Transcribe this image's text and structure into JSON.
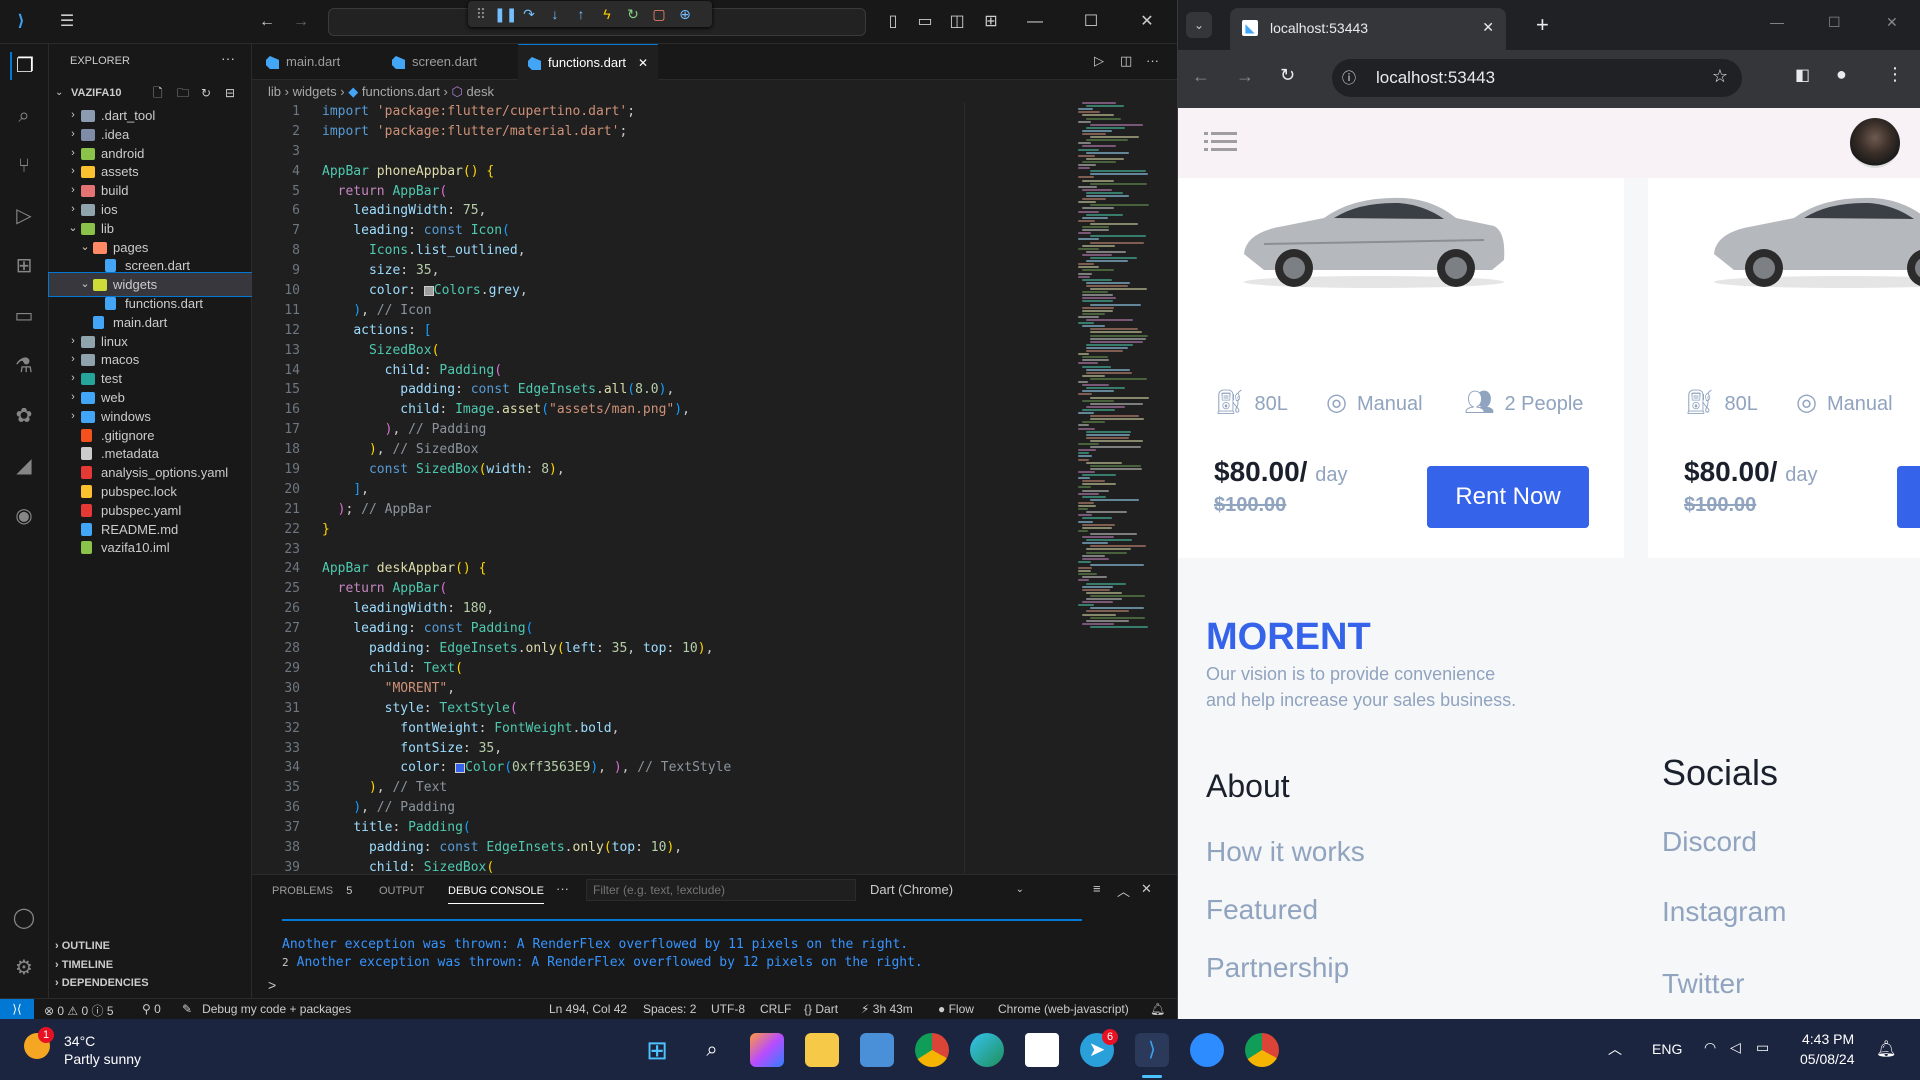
{
  "vscode": {
    "debug_toolbar": [
      "pause",
      "restart",
      "step-over",
      "step-into",
      "step-out",
      "hot-reload",
      "hot-restart",
      "stop",
      "inspect"
    ],
    "explorer": {
      "title": "EXPLORER",
      "project": "VAZIFA10",
      "items": [
        {
          "label": ".dart_tool",
          "kind": "folder",
          "depth": 1,
          "open": false,
          "color": "#8d9bb0"
        },
        {
          "label": ".idea",
          "kind": "folder",
          "depth": 1,
          "open": false,
          "color": "#7e8ca8"
        },
        {
          "label": "android",
          "kind": "folder",
          "depth": 1,
          "open": false,
          "color": "#8bc34a"
        },
        {
          "label": "assets",
          "kind": "folder",
          "depth": 1,
          "open": false,
          "color": "#fbc02d"
        },
        {
          "label": "build",
          "kind": "folder",
          "depth": 1,
          "open": false,
          "color": "#e57373"
        },
        {
          "label": "ios",
          "kind": "folder",
          "depth": 1,
          "open": false,
          "color": "#90a4ae"
        },
        {
          "label": "lib",
          "kind": "folder",
          "depth": 1,
          "open": true,
          "color": "#8bc34a"
        },
        {
          "label": "pages",
          "kind": "folder",
          "depth": 2,
          "open": true,
          "color": "#ff8a65"
        },
        {
          "label": "screen.dart",
          "kind": "dart",
          "depth": 3
        },
        {
          "label": "widgets",
          "kind": "folder",
          "depth": 2,
          "open": true,
          "color": "#cddc39",
          "selected": true
        },
        {
          "label": "functions.dart",
          "kind": "dart",
          "depth": 3
        },
        {
          "label": "main.dart",
          "kind": "dart",
          "depth": 2
        },
        {
          "label": "linux",
          "kind": "folder",
          "depth": 1,
          "open": false,
          "color": "#90a4ae"
        },
        {
          "label": "macos",
          "kind": "folder",
          "depth": 1,
          "open": false,
          "color": "#90a4ae"
        },
        {
          "label": "test",
          "kind": "folder",
          "depth": 1,
          "open": false,
          "color": "#26a69a"
        },
        {
          "label": "web",
          "kind": "folder",
          "depth": 1,
          "open": false,
          "color": "#42a5f5"
        },
        {
          "label": "windows",
          "kind": "folder",
          "depth": 1,
          "open": false,
          "color": "#42a5f5"
        },
        {
          "label": ".gitignore",
          "kind": "git",
          "depth": 1
        },
        {
          "label": ".metadata",
          "kind": "file",
          "depth": 1
        },
        {
          "label": "analysis_options.yaml",
          "kind": "yaml",
          "depth": 1
        },
        {
          "label": "pubspec.lock",
          "kind": "lock",
          "depth": 1
        },
        {
          "label": "pubspec.yaml",
          "kind": "yaml",
          "depth": 1
        },
        {
          "label": "README.md",
          "kind": "info",
          "depth": 1
        },
        {
          "label": "vazifa10.iml",
          "kind": "iml",
          "depth": 1
        }
      ],
      "sections": [
        "OUTLINE",
        "TIMELINE",
        "DEPENDENCIES"
      ]
    },
    "tabs": [
      "main.dart",
      "screen.dart",
      "functions.dart"
    ],
    "active_tab": "functions.dart",
    "breadcrumb": [
      "lib",
      "widgets",
      "functions.dart",
      "desk"
    ],
    "line_numbers": [
      "1",
      "2",
      "3",
      "4",
      "5",
      "6",
      "7",
      "8",
      "9",
      "10",
      "11",
      "12",
      "13",
      "14",
      "15",
      "16",
      "17",
      "18",
      "19",
      "20",
      "21",
      "22",
      "23",
      "24",
      "25",
      "26",
      "27",
      "28",
      "29",
      "30",
      "31",
      "32",
      "33",
      "34",
      "35",
      "36",
      "37",
      "38",
      "39"
    ],
    "panel": {
      "tabs": [
        "PROBLEMS",
        "OUTPUT",
        "DEBUG CONSOLE"
      ],
      "problems_count": "5",
      "active": "DEBUG CONSOLE",
      "filter_placeholder": "Filter (e.g. text, !exclude)",
      "session": "Dart (Chrome)",
      "output": [
        {
          "count": "",
          "text": "Another exception was thrown: A RenderFlex overflowed by 11 pixels on the right."
        },
        {
          "count": "2",
          "text": "Another exception was thrown: A RenderFlex overflowed by 12 pixels on the right."
        }
      ],
      "prompt": ">"
    },
    "status": {
      "errors": "0",
      "warnings": "0",
      "infos": "5",
      "ports": "0",
      "debug": "Debug my code + packages",
      "position": "Ln 494, Col 42",
      "spaces": "Spaces: 2",
      "encoding": "UTF-8",
      "eol": "CRLF",
      "language": "Dart",
      "time": "3h 43m",
      "flow": "Flow",
      "device": "Chrome (web-javascript)"
    }
  },
  "chrome": {
    "tab_title": "localhost:53443",
    "url": "localhost:53443"
  },
  "app": {
    "cars": [
      {
        "fuel": "80L",
        "transmission": "Manual",
        "capacity": "2 People",
        "price": "$80.00/",
        "per": "day",
        "old_price": "$100.00",
        "cta": "Rent Now"
      },
      {
        "fuel": "80L",
        "transmission": "Manual",
        "capacity": "",
        "price": "$80.00/",
        "per": "day",
        "old_price": "$100.00",
        "cta": ""
      }
    ],
    "brand": "MORENT",
    "tagline_1": "Our vision is to provide convenience",
    "tagline_2": "and help increase your sales business.",
    "about_title": "About",
    "about_links": [
      "How it works",
      "Featured",
      "Partnership"
    ],
    "socials_title": "Socials",
    "social_links": [
      "Discord",
      "Instagram",
      "Twitter"
    ],
    "brand_color": "#3563e9"
  },
  "taskbar": {
    "weather_temp": "34°C",
    "weather_desc": "Partly sunny",
    "weather_badge": "1",
    "telegram_badge": "6",
    "language": "ENG",
    "time": "4:43 PM",
    "date": "05/08/24"
  }
}
